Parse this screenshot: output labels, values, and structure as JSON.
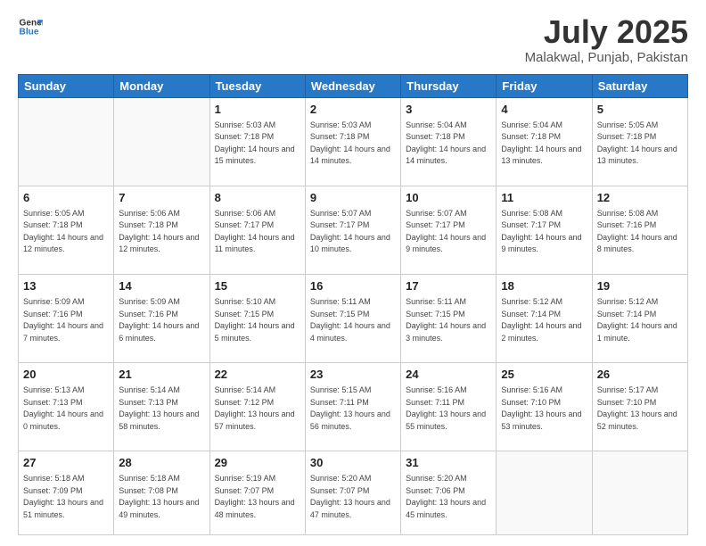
{
  "header": {
    "logo_line1": "General",
    "logo_line2": "Blue",
    "month": "July 2025",
    "location": "Malakwal, Punjab, Pakistan"
  },
  "weekdays": [
    "Sunday",
    "Monday",
    "Tuesday",
    "Wednesday",
    "Thursday",
    "Friday",
    "Saturday"
  ],
  "weeks": [
    [
      {
        "day": "",
        "sunrise": "",
        "sunset": "",
        "daylight": ""
      },
      {
        "day": "",
        "sunrise": "",
        "sunset": "",
        "daylight": ""
      },
      {
        "day": "1",
        "sunrise": "Sunrise: 5:03 AM",
        "sunset": "Sunset: 7:18 PM",
        "daylight": "Daylight: 14 hours and 15 minutes."
      },
      {
        "day": "2",
        "sunrise": "Sunrise: 5:03 AM",
        "sunset": "Sunset: 7:18 PM",
        "daylight": "Daylight: 14 hours and 14 minutes."
      },
      {
        "day": "3",
        "sunrise": "Sunrise: 5:04 AM",
        "sunset": "Sunset: 7:18 PM",
        "daylight": "Daylight: 14 hours and 14 minutes."
      },
      {
        "day": "4",
        "sunrise": "Sunrise: 5:04 AM",
        "sunset": "Sunset: 7:18 PM",
        "daylight": "Daylight: 14 hours and 13 minutes."
      },
      {
        "day": "5",
        "sunrise": "Sunrise: 5:05 AM",
        "sunset": "Sunset: 7:18 PM",
        "daylight": "Daylight: 14 hours and 13 minutes."
      }
    ],
    [
      {
        "day": "6",
        "sunrise": "Sunrise: 5:05 AM",
        "sunset": "Sunset: 7:18 PM",
        "daylight": "Daylight: 14 hours and 12 minutes."
      },
      {
        "day": "7",
        "sunrise": "Sunrise: 5:06 AM",
        "sunset": "Sunset: 7:18 PM",
        "daylight": "Daylight: 14 hours and 12 minutes."
      },
      {
        "day": "8",
        "sunrise": "Sunrise: 5:06 AM",
        "sunset": "Sunset: 7:17 PM",
        "daylight": "Daylight: 14 hours and 11 minutes."
      },
      {
        "day": "9",
        "sunrise": "Sunrise: 5:07 AM",
        "sunset": "Sunset: 7:17 PM",
        "daylight": "Daylight: 14 hours and 10 minutes."
      },
      {
        "day": "10",
        "sunrise": "Sunrise: 5:07 AM",
        "sunset": "Sunset: 7:17 PM",
        "daylight": "Daylight: 14 hours and 9 minutes."
      },
      {
        "day": "11",
        "sunrise": "Sunrise: 5:08 AM",
        "sunset": "Sunset: 7:17 PM",
        "daylight": "Daylight: 14 hours and 9 minutes."
      },
      {
        "day": "12",
        "sunrise": "Sunrise: 5:08 AM",
        "sunset": "Sunset: 7:16 PM",
        "daylight": "Daylight: 14 hours and 8 minutes."
      }
    ],
    [
      {
        "day": "13",
        "sunrise": "Sunrise: 5:09 AM",
        "sunset": "Sunset: 7:16 PM",
        "daylight": "Daylight: 14 hours and 7 minutes."
      },
      {
        "day": "14",
        "sunrise": "Sunrise: 5:09 AM",
        "sunset": "Sunset: 7:16 PM",
        "daylight": "Daylight: 14 hours and 6 minutes."
      },
      {
        "day": "15",
        "sunrise": "Sunrise: 5:10 AM",
        "sunset": "Sunset: 7:15 PM",
        "daylight": "Daylight: 14 hours and 5 minutes."
      },
      {
        "day": "16",
        "sunrise": "Sunrise: 5:11 AM",
        "sunset": "Sunset: 7:15 PM",
        "daylight": "Daylight: 14 hours and 4 minutes."
      },
      {
        "day": "17",
        "sunrise": "Sunrise: 5:11 AM",
        "sunset": "Sunset: 7:15 PM",
        "daylight": "Daylight: 14 hours and 3 minutes."
      },
      {
        "day": "18",
        "sunrise": "Sunrise: 5:12 AM",
        "sunset": "Sunset: 7:14 PM",
        "daylight": "Daylight: 14 hours and 2 minutes."
      },
      {
        "day": "19",
        "sunrise": "Sunrise: 5:12 AM",
        "sunset": "Sunset: 7:14 PM",
        "daylight": "Daylight: 14 hours and 1 minute."
      }
    ],
    [
      {
        "day": "20",
        "sunrise": "Sunrise: 5:13 AM",
        "sunset": "Sunset: 7:13 PM",
        "daylight": "Daylight: 14 hours and 0 minutes."
      },
      {
        "day": "21",
        "sunrise": "Sunrise: 5:14 AM",
        "sunset": "Sunset: 7:13 PM",
        "daylight": "Daylight: 13 hours and 58 minutes."
      },
      {
        "day": "22",
        "sunrise": "Sunrise: 5:14 AM",
        "sunset": "Sunset: 7:12 PM",
        "daylight": "Daylight: 13 hours and 57 minutes."
      },
      {
        "day": "23",
        "sunrise": "Sunrise: 5:15 AM",
        "sunset": "Sunset: 7:11 PM",
        "daylight": "Daylight: 13 hours and 56 minutes."
      },
      {
        "day": "24",
        "sunrise": "Sunrise: 5:16 AM",
        "sunset": "Sunset: 7:11 PM",
        "daylight": "Daylight: 13 hours and 55 minutes."
      },
      {
        "day": "25",
        "sunrise": "Sunrise: 5:16 AM",
        "sunset": "Sunset: 7:10 PM",
        "daylight": "Daylight: 13 hours and 53 minutes."
      },
      {
        "day": "26",
        "sunrise": "Sunrise: 5:17 AM",
        "sunset": "Sunset: 7:10 PM",
        "daylight": "Daylight: 13 hours and 52 minutes."
      }
    ],
    [
      {
        "day": "27",
        "sunrise": "Sunrise: 5:18 AM",
        "sunset": "Sunset: 7:09 PM",
        "daylight": "Daylight: 13 hours and 51 minutes."
      },
      {
        "day": "28",
        "sunrise": "Sunrise: 5:18 AM",
        "sunset": "Sunset: 7:08 PM",
        "daylight": "Daylight: 13 hours and 49 minutes."
      },
      {
        "day": "29",
        "sunrise": "Sunrise: 5:19 AM",
        "sunset": "Sunset: 7:07 PM",
        "daylight": "Daylight: 13 hours and 48 minutes."
      },
      {
        "day": "30",
        "sunrise": "Sunrise: 5:20 AM",
        "sunset": "Sunset: 7:07 PM",
        "daylight": "Daylight: 13 hours and 47 minutes."
      },
      {
        "day": "31",
        "sunrise": "Sunrise: 5:20 AM",
        "sunset": "Sunset: 7:06 PM",
        "daylight": "Daylight: 13 hours and 45 minutes."
      },
      {
        "day": "",
        "sunrise": "",
        "sunset": "",
        "daylight": ""
      },
      {
        "day": "",
        "sunrise": "",
        "sunset": "",
        "daylight": ""
      }
    ]
  ]
}
